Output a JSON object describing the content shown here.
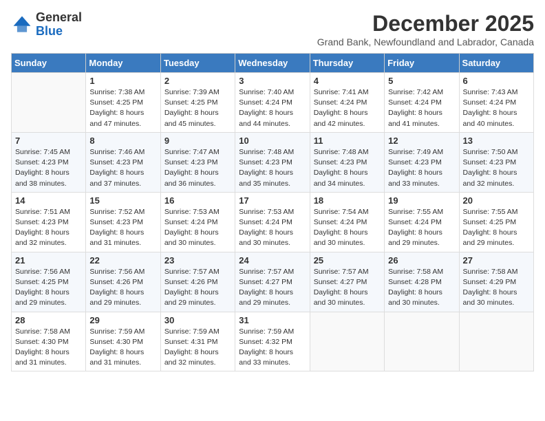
{
  "logo": {
    "general": "General",
    "blue": "Blue"
  },
  "header": {
    "title": "December 2025",
    "subtitle": "Grand Bank, Newfoundland and Labrador, Canada"
  },
  "days": [
    "Sunday",
    "Monday",
    "Tuesday",
    "Wednesday",
    "Thursday",
    "Friday",
    "Saturday"
  ],
  "weeks": [
    [
      {
        "day": "",
        "info": ""
      },
      {
        "day": "1",
        "info": "Sunrise: 7:38 AM\nSunset: 4:25 PM\nDaylight: 8 hours\nand 47 minutes."
      },
      {
        "day": "2",
        "info": "Sunrise: 7:39 AM\nSunset: 4:25 PM\nDaylight: 8 hours\nand 45 minutes."
      },
      {
        "day": "3",
        "info": "Sunrise: 7:40 AM\nSunset: 4:24 PM\nDaylight: 8 hours\nand 44 minutes."
      },
      {
        "day": "4",
        "info": "Sunrise: 7:41 AM\nSunset: 4:24 PM\nDaylight: 8 hours\nand 42 minutes."
      },
      {
        "day": "5",
        "info": "Sunrise: 7:42 AM\nSunset: 4:24 PM\nDaylight: 8 hours\nand 41 minutes."
      },
      {
        "day": "6",
        "info": "Sunrise: 7:43 AM\nSunset: 4:24 PM\nDaylight: 8 hours\nand 40 minutes."
      }
    ],
    [
      {
        "day": "7",
        "info": "Sunrise: 7:45 AM\nSunset: 4:23 PM\nDaylight: 8 hours\nand 38 minutes."
      },
      {
        "day": "8",
        "info": "Sunrise: 7:46 AM\nSunset: 4:23 PM\nDaylight: 8 hours\nand 37 minutes."
      },
      {
        "day": "9",
        "info": "Sunrise: 7:47 AM\nSunset: 4:23 PM\nDaylight: 8 hours\nand 36 minutes."
      },
      {
        "day": "10",
        "info": "Sunrise: 7:48 AM\nSunset: 4:23 PM\nDaylight: 8 hours\nand 35 minutes."
      },
      {
        "day": "11",
        "info": "Sunrise: 7:48 AM\nSunset: 4:23 PM\nDaylight: 8 hours\nand 34 minutes."
      },
      {
        "day": "12",
        "info": "Sunrise: 7:49 AM\nSunset: 4:23 PM\nDaylight: 8 hours\nand 33 minutes."
      },
      {
        "day": "13",
        "info": "Sunrise: 7:50 AM\nSunset: 4:23 PM\nDaylight: 8 hours\nand 32 minutes."
      }
    ],
    [
      {
        "day": "14",
        "info": "Sunrise: 7:51 AM\nSunset: 4:23 PM\nDaylight: 8 hours\nand 32 minutes."
      },
      {
        "day": "15",
        "info": "Sunrise: 7:52 AM\nSunset: 4:23 PM\nDaylight: 8 hours\nand 31 minutes."
      },
      {
        "day": "16",
        "info": "Sunrise: 7:53 AM\nSunset: 4:24 PM\nDaylight: 8 hours\nand 30 minutes."
      },
      {
        "day": "17",
        "info": "Sunrise: 7:53 AM\nSunset: 4:24 PM\nDaylight: 8 hours\nand 30 minutes."
      },
      {
        "day": "18",
        "info": "Sunrise: 7:54 AM\nSunset: 4:24 PM\nDaylight: 8 hours\nand 30 minutes."
      },
      {
        "day": "19",
        "info": "Sunrise: 7:55 AM\nSunset: 4:24 PM\nDaylight: 8 hours\nand 29 minutes."
      },
      {
        "day": "20",
        "info": "Sunrise: 7:55 AM\nSunset: 4:25 PM\nDaylight: 8 hours\nand 29 minutes."
      }
    ],
    [
      {
        "day": "21",
        "info": "Sunrise: 7:56 AM\nSunset: 4:25 PM\nDaylight: 8 hours\nand 29 minutes."
      },
      {
        "day": "22",
        "info": "Sunrise: 7:56 AM\nSunset: 4:26 PM\nDaylight: 8 hours\nand 29 minutes."
      },
      {
        "day": "23",
        "info": "Sunrise: 7:57 AM\nSunset: 4:26 PM\nDaylight: 8 hours\nand 29 minutes."
      },
      {
        "day": "24",
        "info": "Sunrise: 7:57 AM\nSunset: 4:27 PM\nDaylight: 8 hours\nand 29 minutes."
      },
      {
        "day": "25",
        "info": "Sunrise: 7:57 AM\nSunset: 4:27 PM\nDaylight: 8 hours\nand 30 minutes."
      },
      {
        "day": "26",
        "info": "Sunrise: 7:58 AM\nSunset: 4:28 PM\nDaylight: 8 hours\nand 30 minutes."
      },
      {
        "day": "27",
        "info": "Sunrise: 7:58 AM\nSunset: 4:29 PM\nDaylight: 8 hours\nand 30 minutes."
      }
    ],
    [
      {
        "day": "28",
        "info": "Sunrise: 7:58 AM\nSunset: 4:30 PM\nDaylight: 8 hours\nand 31 minutes."
      },
      {
        "day": "29",
        "info": "Sunrise: 7:59 AM\nSunset: 4:30 PM\nDaylight: 8 hours\nand 31 minutes."
      },
      {
        "day": "30",
        "info": "Sunrise: 7:59 AM\nSunset: 4:31 PM\nDaylight: 8 hours\nand 32 minutes."
      },
      {
        "day": "31",
        "info": "Sunrise: 7:59 AM\nSunset: 4:32 PM\nDaylight: 8 hours\nand 33 minutes."
      },
      {
        "day": "",
        "info": ""
      },
      {
        "day": "",
        "info": ""
      },
      {
        "day": "",
        "info": ""
      }
    ]
  ]
}
